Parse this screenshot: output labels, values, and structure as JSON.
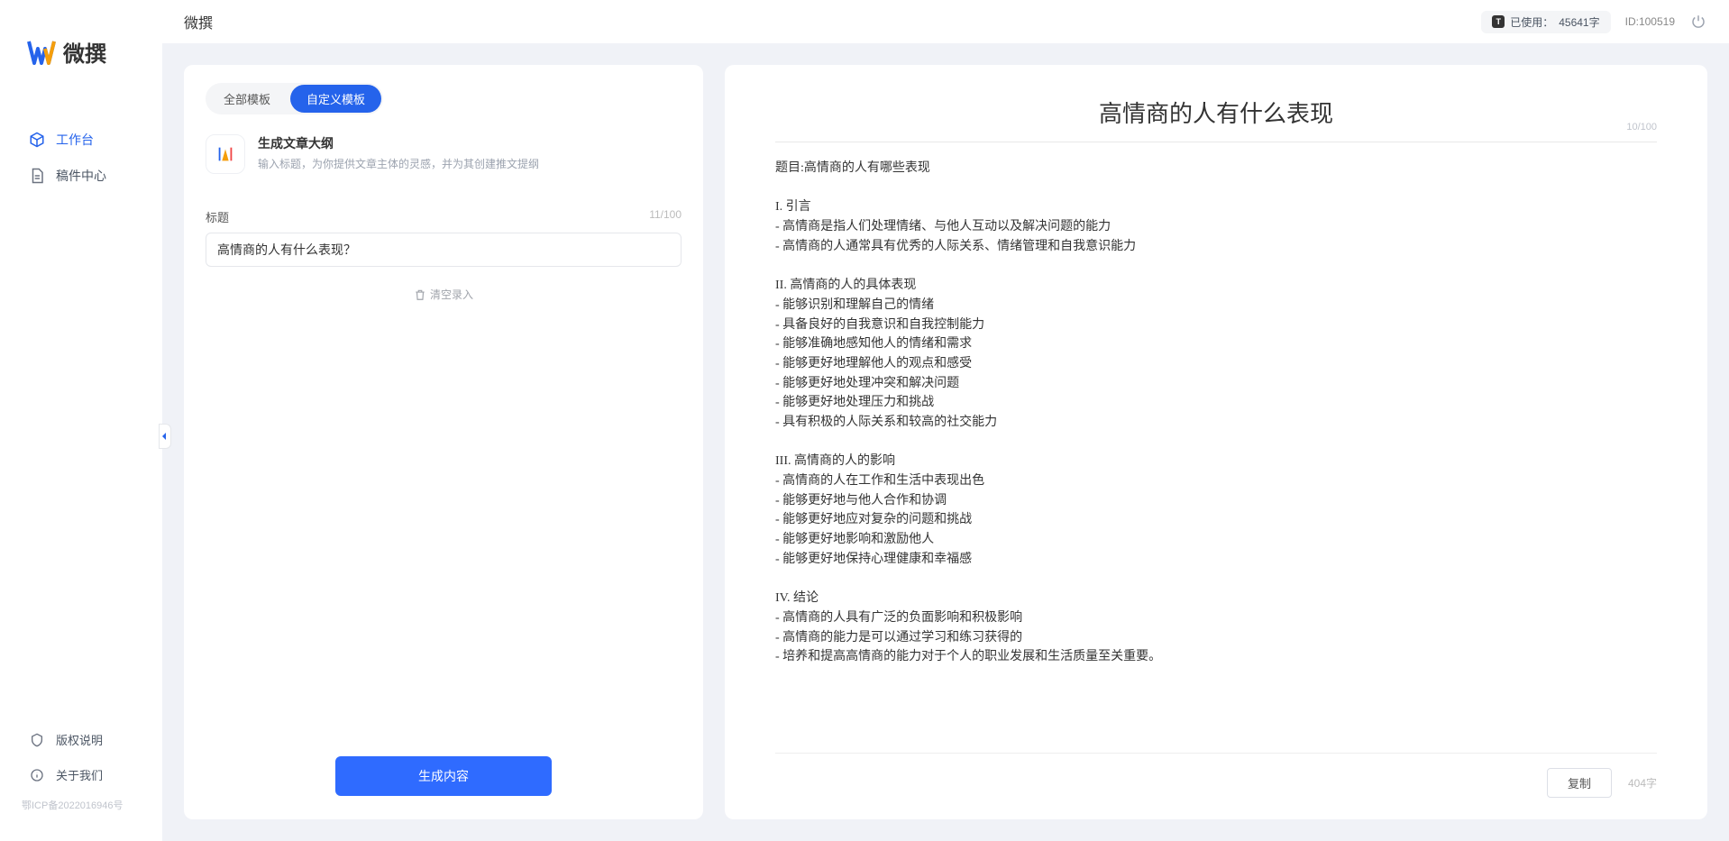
{
  "brand": {
    "name": "微撰"
  },
  "sidebar": {
    "items": [
      {
        "label": "工作台",
        "icon": "cube-icon",
        "active": true
      },
      {
        "label": "稿件中心",
        "icon": "document-icon",
        "active": false
      }
    ],
    "bottom": [
      {
        "label": "版权说明",
        "icon": "shield-icon"
      },
      {
        "label": "关于我们",
        "icon": "info-icon"
      }
    ],
    "legal": "鄂ICP备2022016946号"
  },
  "header": {
    "title": "微撰",
    "usage_prefix": "已使用：",
    "usage_value": "45641字",
    "id_label": "ID:100519"
  },
  "left": {
    "tabs": [
      {
        "label": "全部模板",
        "active": false
      },
      {
        "label": "自定义模板",
        "active": true
      }
    ],
    "template": {
      "title": "生成文章大纲",
      "desc": "输入标题，为你提供文章主体的灵感，并为其创建推文提纲"
    },
    "field": {
      "label": "标题",
      "counter": "11/100",
      "value": "高情商的人有什么表现？"
    },
    "clear_label": "清空录入",
    "generate_label": "生成内容"
  },
  "right": {
    "title": "高情商的人有什么表现",
    "title_counter": "10/100",
    "body": "题目:高情商的人有哪些表现\n\nI. 引言\n- 高情商是指人们处理情绪、与他人互动以及解决问题的能力\n- 高情商的人通常具有优秀的人际关系、情绪管理和自我意识能力\n\nII. 高情商的人的具体表现\n- 能够识别和理解自己的情绪\n- 具备良好的自我意识和自我控制能力\n- 能够准确地感知他人的情绪和需求\n- 能够更好地理解他人的观点和感受\n- 能够更好地处理冲突和解决问题\n- 能够更好地处理压力和挑战\n- 具有积极的人际关系和较高的社交能力\n\nIII. 高情商的人的影响\n- 高情商的人在工作和生活中表现出色\n- 能够更好地与他人合作和协调\n- 能够更好地应对复杂的问题和挑战\n- 能够更好地影响和激励他人\n- 能够更好地保持心理健康和幸福感\n\nIV. 结论\n- 高情商的人具有广泛的负面影响和积极影响\n- 高情商的能力是可以通过学习和练习获得的\n- 培养和提高高情商的能力对于个人的职业发展和生活质量至关重要。",
    "copy_label": "复制",
    "word_count": "404字"
  }
}
